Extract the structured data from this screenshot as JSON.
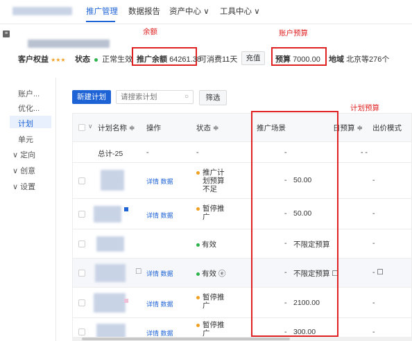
{
  "nav": {
    "items": [
      "推广管理",
      "数据报告",
      "资产中心 ∨",
      "工具中心 ∨"
    ],
    "active_index": 0
  },
  "annotations": {
    "balance": "余额",
    "account_budget": "账户预算",
    "plan_budget": "计划预算"
  },
  "account": {
    "benefit_label": "客户权益",
    "stars": "★★★",
    "status_label": "状态",
    "status_value": "正常生效",
    "balance_label": "推广余额",
    "balance_value": "64261.38",
    "days_left": "可消费11天",
    "recharge": "充值",
    "budget_label": "预算",
    "budget_value": "7000.00",
    "region_label": "地域",
    "region_value": "北京等276个"
  },
  "sidebar": {
    "items": [
      "账户...",
      "优化...",
      "计划",
      "单元",
      "∨ 定向",
      "∨ 创意",
      "∨ 设置"
    ],
    "active_index": 2
  },
  "toolbar": {
    "new_plan": "新建计划",
    "search_placeholder": "请搜索计划",
    "filter": "筛选"
  },
  "table": {
    "headers": {
      "name": "计划名称 ≑",
      "ops": "操作",
      "status": "状态 ≑",
      "scene": "推广场景",
      "daily_budget": "日预算 ≑",
      "bid_mode": "出价模式"
    },
    "total": {
      "name": "总计-25",
      "ops": "-",
      "status": "-",
      "budget": "-",
      "bid": "- -"
    },
    "ops_label": "详情  数据",
    "rows": [
      {
        "status": [
          "推广计",
          "划预算",
          "不足"
        ],
        "status_color": "#f0a020",
        "scene": "-",
        "budget": "50.00",
        "bid": "-"
      },
      {
        "status": [
          "暂停推",
          "广"
        ],
        "status_color": "#f0a020",
        "scene": "-",
        "budget": "50.00",
        "bid": "-"
      },
      {
        "status": [
          "有效"
        ],
        "status_color": "#2cb44a",
        "scene": "-",
        "budget": "不限定预算",
        "bid": "-"
      },
      {
        "status": [
          "有效 ⓔ"
        ],
        "status_color": "#2cb44a",
        "scene": "-",
        "budget": "不限定预算 ☐",
        "bid": "- ☐"
      },
      {
        "status": [
          "暂停推",
          "广"
        ],
        "status_color": "#f0a020",
        "scene": "-",
        "budget": "2100.00",
        "bid": "-"
      },
      {
        "status": [
          "暂停推",
          "广"
        ],
        "status_color": "#f0a020",
        "scene": "-",
        "budget": "300.00",
        "bid": "-"
      }
    ]
  }
}
